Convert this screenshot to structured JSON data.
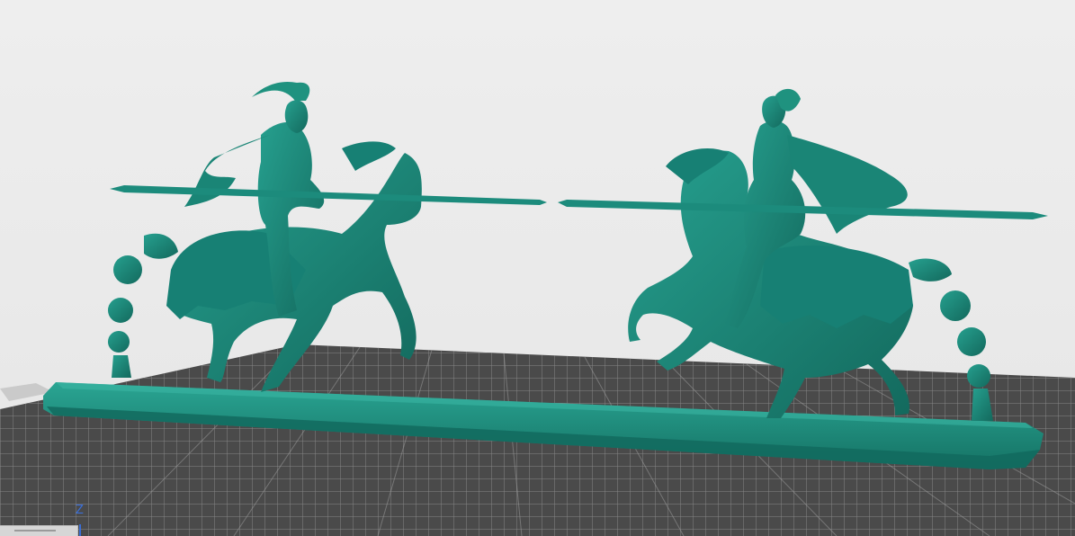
{
  "viewer": {
    "axis_indicator": "Z",
    "colors": {
      "background": "#ebebeb",
      "grid_plate": "#4a4a4a",
      "grid_lines": "#8e8e8e",
      "model": "#1e8a7c",
      "model_shadow": "#146b60",
      "model_highlight": "#2aa593",
      "axis_z": "#3a6fd8"
    },
    "model": {
      "name_icon": "jousting-knights-model"
    }
  }
}
